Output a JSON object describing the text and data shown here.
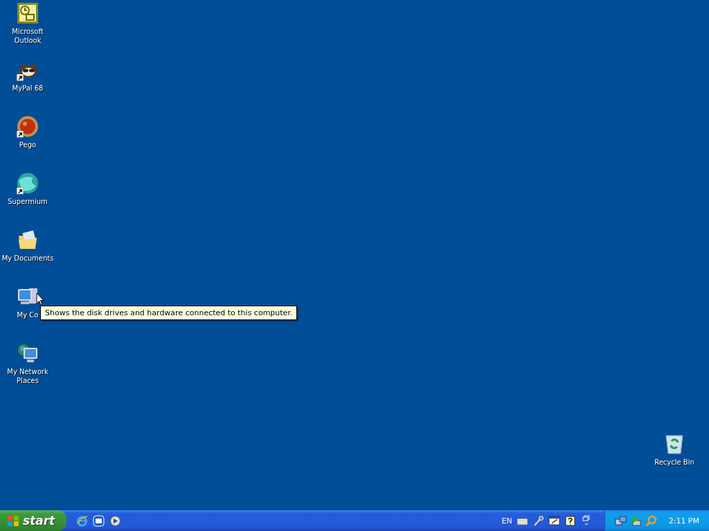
{
  "desktop_icons": [
    {
      "label": "Microsoft Outlook",
      "kind": "outlook",
      "shortcut": false
    },
    {
      "label": "MyPal 68",
      "kind": "raccoon",
      "shortcut": true
    },
    {
      "label": "Pego",
      "kind": "pego",
      "shortcut": true
    },
    {
      "label": "Supermium",
      "kind": "supermium",
      "shortcut": true
    },
    {
      "label": "My Documents",
      "kind": "documents",
      "shortcut": false
    },
    {
      "label": "My Co",
      "kind": "computer",
      "shortcut": false
    },
    {
      "label": "My Network Places",
      "kind": "network",
      "shortcut": false
    }
  ],
  "tooltip": {
    "text": "Shows the disk drives and hardware connected to this computer."
  },
  "recycle_bin": {
    "label": "Recycle Bin"
  },
  "taskbar": {
    "start_label": "start",
    "language": "EN",
    "clock": "2:11 PM"
  }
}
